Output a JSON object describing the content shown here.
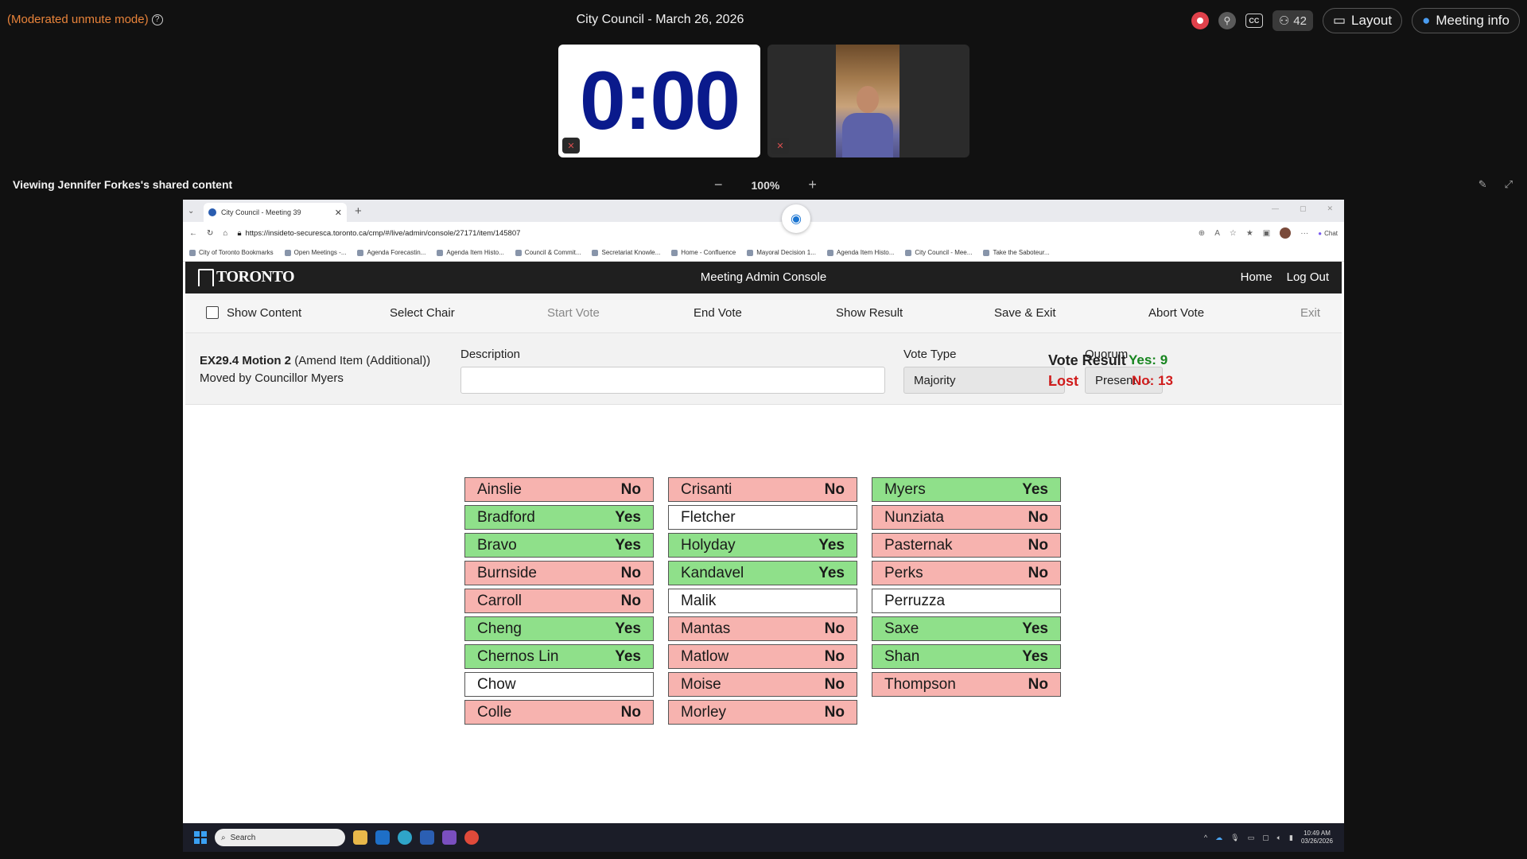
{
  "top": {
    "mode": "(Moderated unmute mode)",
    "title": "City Council - March 26, 2026",
    "participants": "42",
    "layout_label": "Layout",
    "meeting_info_label": "Meeting info"
  },
  "tiles": {
    "timer": "0:00"
  },
  "share": {
    "label": "Viewing Jennifer Forkes's shared content",
    "zoom": "100%"
  },
  "browser": {
    "tab_title": "City Council - Meeting 39",
    "url": "https://insideto-securesca.toronto.ca/cmp/#/live/admin/console/27171/item/145807",
    "chat": "Chat",
    "bookmarks": [
      "City of Toronto Bookmarks",
      "Open Meetings -...",
      "Agenda Forecastin...",
      "Agenda Item Histo...",
      "Council & Commit...",
      "Secretariat Knowle...",
      "Home - Confluence",
      "Mayoral Decision 1...",
      "Agenda Item Histo...",
      "City Council - Mee...",
      "Take the Saboteur..."
    ]
  },
  "app": {
    "logo": "TORONTO",
    "title": "Meeting Admin Console",
    "home": "Home",
    "logout": "Log Out",
    "toolbar": {
      "show_content": "Show Content",
      "select_chair": "Select Chair",
      "start_vote": "Start Vote",
      "end_vote": "End Vote",
      "show_result": "Show Result",
      "save_exit": "Save & Exit",
      "abort_vote": "Abort Vote",
      "exit": "Exit"
    },
    "motion": {
      "id": "EX29.4 Motion 2",
      "type": "(Amend Item (Additional))",
      "moved_by": "Moved by Councillor Myers",
      "description_label": "Description",
      "description_value": "",
      "vote_type_label": "Vote Type",
      "vote_type_value": "Majority",
      "quorum_label": "Quorum",
      "quorum_value": "Present",
      "vote_result_label": "Vote Result",
      "result": "Lost",
      "yes": "Yes: 9",
      "no": "No: 13"
    },
    "columns": [
      [
        {
          "name": "Ainslie",
          "vote": "No"
        },
        {
          "name": "Bradford",
          "vote": "Yes"
        },
        {
          "name": "Bravo",
          "vote": "Yes"
        },
        {
          "name": "Burnside",
          "vote": "No"
        },
        {
          "name": "Carroll",
          "vote": "No"
        },
        {
          "name": "Cheng",
          "vote": "Yes"
        },
        {
          "name": "Chernos Lin",
          "vote": "Yes"
        },
        {
          "name": "Chow",
          "vote": ""
        },
        {
          "name": "Colle",
          "vote": "No"
        }
      ],
      [
        {
          "name": "Crisanti",
          "vote": "No"
        },
        {
          "name": "Fletcher",
          "vote": ""
        },
        {
          "name": "Holyday",
          "vote": "Yes"
        },
        {
          "name": "Kandavel",
          "vote": "Yes"
        },
        {
          "name": "Malik",
          "vote": ""
        },
        {
          "name": "Mantas",
          "vote": "No"
        },
        {
          "name": "Matlow",
          "vote": "No"
        },
        {
          "name": "Moise",
          "vote": "No"
        },
        {
          "name": "Morley",
          "vote": "No"
        }
      ],
      [
        {
          "name": "Myers",
          "vote": "Yes"
        },
        {
          "name": "Nunziata",
          "vote": "No"
        },
        {
          "name": "Pasternak",
          "vote": "No"
        },
        {
          "name": "Perks",
          "vote": "No"
        },
        {
          "name": "Perruzza",
          "vote": ""
        },
        {
          "name": "Saxe",
          "vote": "Yes"
        },
        {
          "name": "Shan",
          "vote": "Yes"
        },
        {
          "name": "Thompson",
          "vote": "No"
        }
      ]
    ]
  },
  "taskbar": {
    "search": "Search",
    "time": "10:49 AM",
    "date": "03/26/2026"
  },
  "colors": {
    "yes": "#8fe08a",
    "no": "#f7b3af",
    "timer": "#0a1a8c",
    "lost": "#d01c1c",
    "yes_text": "#17851f"
  }
}
